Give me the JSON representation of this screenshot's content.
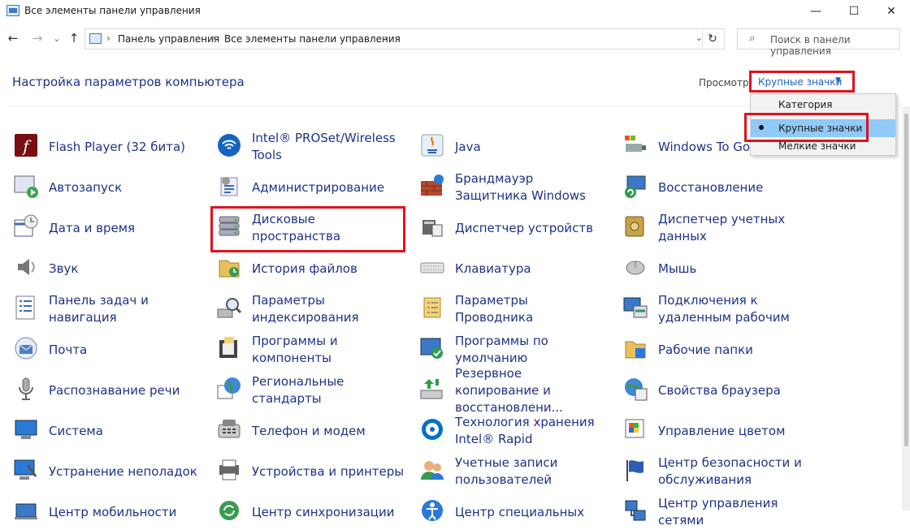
{
  "window": {
    "title": "Все элементы панели управления",
    "minimize_glyph": "—",
    "maximize_glyph": "☐",
    "close_glyph": "✕"
  },
  "address": {
    "back_glyph": "←",
    "forward_glyph": "→",
    "recent_glyph": "⌄",
    "up_glyph": "↑",
    "crumb_sep": "›",
    "breadcrumbs": [
      "Панель управления",
      "Все элементы панели управления"
    ],
    "dropdown_glyph": "⌄",
    "refresh_glyph": "↻"
  },
  "search": {
    "icon_glyph": "⌕",
    "placeholder": "Поиск в панели управления"
  },
  "header": {
    "title": "Настройка параметров компьютера",
    "view_label": "Просмотр:",
    "view_value": "Крупные значки",
    "view_arrow": "▼"
  },
  "view_menu": {
    "options": [
      "Категория",
      "Крупные значки",
      "Мелкие значки"
    ],
    "selected_index": 1
  },
  "colors": {
    "link": "#1e3287",
    "highlight": "#e0121c",
    "menu_selected": "#91c9f7"
  },
  "items": [
    {
      "label": "Flash Player (32 бита)",
      "icon": "flash-icon"
    },
    {
      "label": "Intel® PROSet/Wireless Tools",
      "icon": "wireless-icon"
    },
    {
      "label": "Java",
      "icon": "java-icon"
    },
    {
      "label": "Windows To Go",
      "icon": "usb-drive-icon"
    },
    {
      "label": "Автозапуск",
      "icon": "autoplay-icon"
    },
    {
      "label": "Администрирование",
      "icon": "admin-tools-icon"
    },
    {
      "label": "Брандмауэр Защитника Windows",
      "icon": "firewall-icon"
    },
    {
      "label": "Восстановление",
      "icon": "recovery-icon"
    },
    {
      "label": "Дата и время",
      "icon": "calendar-clock-icon"
    },
    {
      "label": "Дисковые пространства",
      "icon": "storage-spaces-icon"
    },
    {
      "label": "Диспетчер устройств",
      "icon": "device-manager-icon"
    },
    {
      "label": "Диспетчер учетных данных",
      "icon": "credential-vault-icon"
    },
    {
      "label": "Звук",
      "icon": "speaker-icon"
    },
    {
      "label": "История файлов",
      "icon": "file-history-icon"
    },
    {
      "label": "Клавиатура",
      "icon": "keyboard-icon"
    },
    {
      "label": "Мышь",
      "icon": "mouse-icon"
    },
    {
      "label": "Панель задач и навигация",
      "icon": "taskbar-icon"
    },
    {
      "label": "Параметры индексирования",
      "icon": "indexing-icon"
    },
    {
      "label": "Параметры Проводника",
      "icon": "folder-options-icon"
    },
    {
      "label": "Подключения к удаленным рабочим",
      "icon": "remote-desktop-icon"
    },
    {
      "label": "Почта",
      "icon": "mail-icon"
    },
    {
      "label": "Программы и компоненты",
      "icon": "programs-icon"
    },
    {
      "label": "Программы по умолчанию",
      "icon": "default-programs-icon"
    },
    {
      "label": "Рабочие папки",
      "icon": "work-folders-icon"
    },
    {
      "label": "Распознавание речи",
      "icon": "microphone-icon"
    },
    {
      "label": "Региональные стандарты",
      "icon": "region-icon"
    },
    {
      "label": "Резервное копирование и восстановлени...",
      "icon": "backup-icon"
    },
    {
      "label": "Свойства браузера",
      "icon": "internet-options-icon"
    },
    {
      "label": "Система",
      "icon": "system-icon"
    },
    {
      "label": "Телефон и модем",
      "icon": "phone-modem-icon"
    },
    {
      "label": "Технология хранения Intel® Rapid",
      "icon": "intel-rst-icon"
    },
    {
      "label": "Управление цветом",
      "icon": "color-management-icon"
    },
    {
      "label": "Устранение неполадок",
      "icon": "troubleshooting-icon"
    },
    {
      "label": "Устройства и принтеры",
      "icon": "printer-icon"
    },
    {
      "label": "Учетные записи пользователей",
      "icon": "user-accounts-icon"
    },
    {
      "label": "Центр безопасности и обслуживания",
      "icon": "security-flag-icon"
    },
    {
      "label": "Центр мобильности",
      "icon": "mobility-icon"
    },
    {
      "label": "Центр синхронизации",
      "icon": "sync-icon"
    },
    {
      "label": "Центр специальных",
      "icon": "accessibility-icon"
    },
    {
      "label": "Центр управления сетями",
      "icon": "network-icon"
    }
  ]
}
